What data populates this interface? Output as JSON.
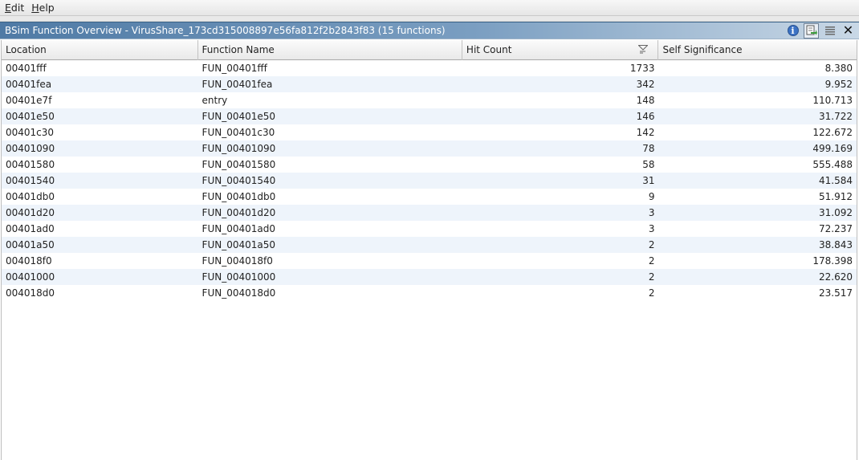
{
  "menu": {
    "items": [
      {
        "mnemonic": "E",
        "rest": "dit"
      },
      {
        "mnemonic": "H",
        "rest": "elp"
      }
    ]
  },
  "window": {
    "title": "BSim Function Overview - VirusShare_173cd315008897e56fa812f2b2843f83 (15 functions)",
    "icons": [
      "info-icon",
      "select-functions-icon",
      "list-options-icon",
      "close-icon"
    ]
  },
  "table": {
    "columns": [
      "Location",
      "Function Name",
      "Hit Count",
      "Self Significance"
    ],
    "sorted_column": "Hit Count",
    "rows": [
      {
        "location": "00401fff",
        "name": "FUN_00401fff",
        "hits": "1733",
        "sig": "8.380"
      },
      {
        "location": "00401fea",
        "name": "FUN_00401fea",
        "hits": "342",
        "sig": "9.952"
      },
      {
        "location": "00401e7f",
        "name": "entry",
        "hits": "148",
        "sig": "110.713"
      },
      {
        "location": "00401e50",
        "name": "FUN_00401e50",
        "hits": "146",
        "sig": "31.722"
      },
      {
        "location": "00401c30",
        "name": "FUN_00401c30",
        "hits": "142",
        "sig": "122.672"
      },
      {
        "location": "00401090",
        "name": "FUN_00401090",
        "hits": "78",
        "sig": "499.169"
      },
      {
        "location": "00401580",
        "name": "FUN_00401580",
        "hits": "58",
        "sig": "555.488"
      },
      {
        "location": "00401540",
        "name": "FUN_00401540",
        "hits": "31",
        "sig": "41.584"
      },
      {
        "location": "00401db0",
        "name": "FUN_00401db0",
        "hits": "9",
        "sig": "51.912"
      },
      {
        "location": "00401d20",
        "name": "FUN_00401d20",
        "hits": "3",
        "sig": "31.092"
      },
      {
        "location": "00401ad0",
        "name": "FUN_00401ad0",
        "hits": "3",
        "sig": "72.237"
      },
      {
        "location": "00401a50",
        "name": "FUN_00401a50",
        "hits": "2",
        "sig": "38.843"
      },
      {
        "location": "004018f0",
        "name": "FUN_004018f0",
        "hits": "2",
        "sig": "178.398"
      },
      {
        "location": "00401000",
        "name": "FUN_00401000",
        "hits": "2",
        "sig": "22.620"
      },
      {
        "location": "004018d0",
        "name": "FUN_004018d0",
        "hits": "2",
        "sig": "23.517"
      }
    ]
  },
  "colors": {
    "title_gradient_start": "#4f7aa5",
    "title_gradient_end": "#c9d8e6",
    "alt_row": "#eef4fb"
  }
}
